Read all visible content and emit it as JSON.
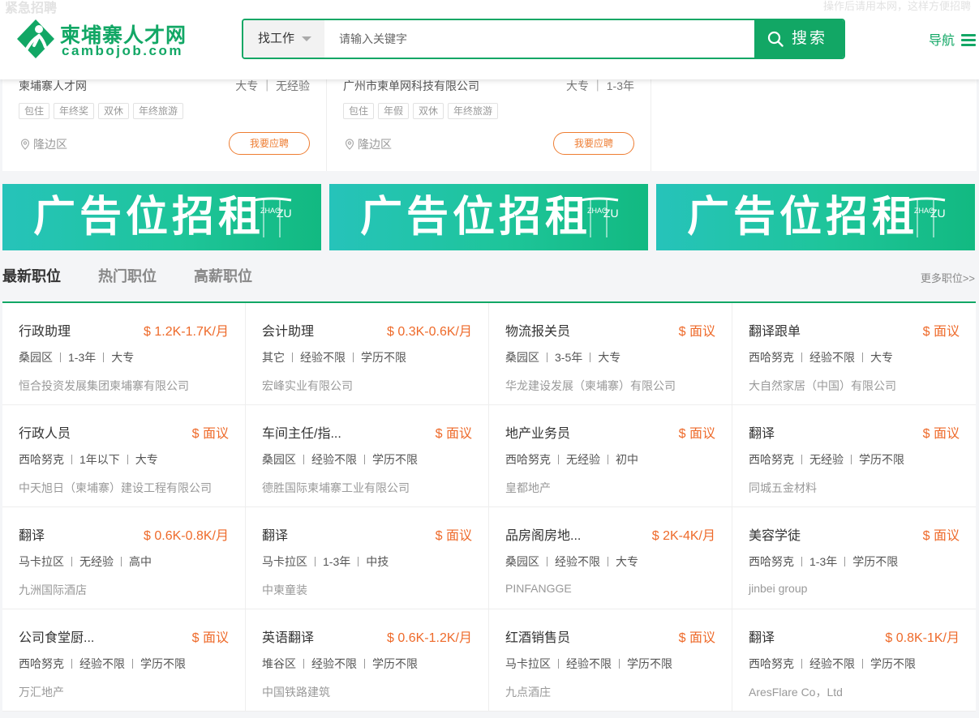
{
  "header": {
    "behind_title": "紧急招聘",
    "behind_right": "操作后请用本网，这样方便招聘",
    "logo": {
      "cn": "柬埔寨人才网",
      "en": "cambojob.com",
      "brand_color": "#12a765"
    },
    "search": {
      "type_label": "找工作",
      "placeholder": "请输入关键字",
      "button_label": "搜索"
    },
    "nav_label": "导航"
  },
  "urgent": [
    {
      "company": "柬埔寨人才网",
      "education": "大专",
      "experience": "无经验",
      "tags": [
        "包住",
        "年终奖",
        "双休",
        "年终旅游"
      ],
      "location": "隆边区",
      "apply_label": "我要应聘"
    },
    {
      "company": "广州市柬单网科技有限公司",
      "education": "大专",
      "experience": "1-3年",
      "tags": [
        "包住",
        "年假",
        "双休",
        "年终旅游"
      ],
      "location": "隆边区",
      "apply_label": "我要应聘"
    }
  ],
  "ads": [
    {
      "text": "广告位招租",
      "sub_a": "ZHAO",
      "sub_b": "ZU"
    },
    {
      "text": "广告位招租",
      "sub_a": "ZHAO",
      "sub_b": "ZU"
    },
    {
      "text": "广告位招租",
      "sub_a": "ZHAO",
      "sub_b": "ZU"
    }
  ],
  "tabs": [
    {
      "label": "最新职位",
      "active": true
    },
    {
      "label": "热门职位",
      "active": false
    },
    {
      "label": "高薪职位",
      "active": false
    }
  ],
  "more_label": "更多职位>>",
  "accent_color": "#ee6a2a",
  "jobs": [
    {
      "title": "行政助理",
      "salary": "$ 1.2K-1.7K/月",
      "area": "桑园区",
      "exp": "1-3年",
      "edu": "大专",
      "company": "恒合投资发展集团柬埔寨有限公司"
    },
    {
      "title": "会计助理",
      "salary": "$ 0.3K-0.6K/月",
      "area": "其它",
      "exp": "经验不限",
      "edu": "学历不限",
      "company": "宏峰实业有限公司"
    },
    {
      "title": "物流报关员",
      "salary": "$ 面议",
      "area": "桑园区",
      "exp": "3-5年",
      "edu": "大专",
      "company": "华龙建设发展（柬埔寨）有限公司"
    },
    {
      "title": "翻译跟单",
      "salary": "$ 面议",
      "area": "西哈努克",
      "exp": "经验不限",
      "edu": "大专",
      "company": "大自然家居（中国）有限公司"
    },
    {
      "title": "行政人员",
      "salary": "$ 面议",
      "area": "西哈努克",
      "exp": "1年以下",
      "edu": "大专",
      "company": "中天旭日（柬埔寨）建设工程有限公司"
    },
    {
      "title": "车间主任/指...",
      "salary": "$ 面议",
      "area": "桑园区",
      "exp": "经验不限",
      "edu": "学历不限",
      "company": "德胜国际柬埔寨工业有限公司"
    },
    {
      "title": "地产业务员",
      "salary": "$ 面议",
      "area": "西哈努克",
      "exp": "无经验",
      "edu": "初中",
      "company": "皇都地产"
    },
    {
      "title": "翻译",
      "salary": "$ 面议",
      "area": "西哈努克",
      "exp": "无经验",
      "edu": "学历不限",
      "company": "同城五金材料"
    },
    {
      "title": "翻译",
      "salary": "$ 0.6K-0.8K/月",
      "area": "马卡拉区",
      "exp": "无经验",
      "edu": "高中",
      "company": "九洲国际酒店"
    },
    {
      "title": "翻译",
      "salary": "$ 面议",
      "area": "马卡拉区",
      "exp": "1-3年",
      "edu": "中技",
      "company": "中柬童装"
    },
    {
      "title": "品房阁房地...",
      "salary": "$ 2K-4K/月",
      "area": "桑园区",
      "exp": "经验不限",
      "edu": "大专",
      "company": "PINFANGGE"
    },
    {
      "title": "美容学徒",
      "salary": "$ 面议",
      "area": "西哈努克",
      "exp": "1-3年",
      "edu": "学历不限",
      "company": "jinbei group"
    },
    {
      "title": "公司食堂厨...",
      "salary": "$ 面议",
      "area": "西哈努克",
      "exp": "经验不限",
      "edu": "学历不限",
      "company": "万汇地产"
    },
    {
      "title": "英语翻译",
      "salary": "$ 0.6K-1.2K/月",
      "area": "堆谷区",
      "exp": "经验不限",
      "edu": "学历不限",
      "company": "中国铁路建筑"
    },
    {
      "title": "红酒销售员",
      "salary": "$ 面议",
      "area": "马卡拉区",
      "exp": "经验不限",
      "edu": "学历不限",
      "company": "九点酒庄"
    },
    {
      "title": "翻译",
      "salary": "$ 0.8K-1K/月",
      "area": "西哈努克",
      "exp": "经验不限",
      "edu": "学历不限",
      "company": "AresFlare Co，Ltd"
    }
  ]
}
